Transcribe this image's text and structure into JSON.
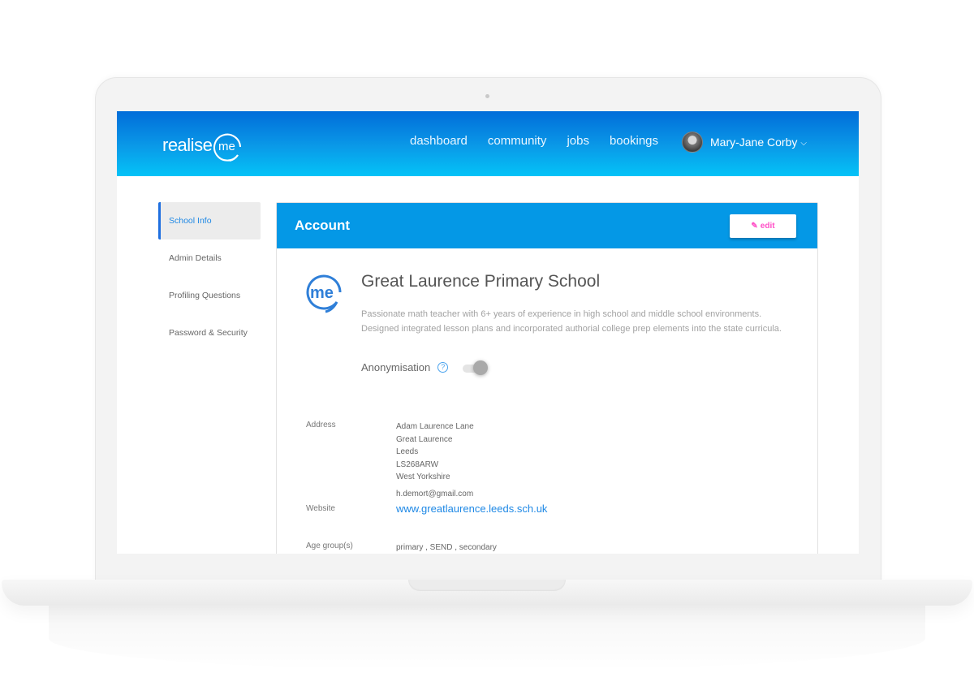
{
  "header": {
    "logo_text": "realise",
    "logo_badge": "me",
    "nav": [
      {
        "label": "dashboard"
      },
      {
        "label": "community"
      },
      {
        "label": "jobs"
      },
      {
        "label": "bookings"
      }
    ],
    "user_name": "Mary-Jane Corby",
    "user_chevron": "⌵"
  },
  "sidebar": {
    "items": [
      {
        "label": "School Info",
        "active": true
      },
      {
        "label": "Admin Details",
        "active": false
      },
      {
        "label": "Profiling Questions",
        "active": false
      },
      {
        "label": "Password & Security",
        "active": false
      }
    ]
  },
  "card": {
    "title": "Account",
    "edit_label": "edit",
    "edit_icon": "✎",
    "school_name": "Great Laurence Primary School",
    "logo_badge": "me",
    "bio": "Passionate math teacher with 6+ years of experience in high school and middle school environments. Designed integrated lesson plans and incorporated authorial college prep elements into the state curricula.",
    "anonymisation": {
      "label": "Anonymisation",
      "help_icon": "?",
      "enabled": false
    },
    "details": {
      "address_label": "Address",
      "address_lines": [
        "Adam Laurence Lane",
        "Great Laurence",
        "Leeds",
        "LS268ARW",
        "West Yorkshire"
      ],
      "email": "h.demort@gmail.com",
      "website_label": "Website",
      "website": "www.greatlaurence.leeds.sch.uk",
      "age_groups_label": "Age group(s)",
      "age_groups": "primary ,  SEND ,  secondary"
    }
  },
  "colors": {
    "header_top": "#016dd9",
    "header_bottom": "#04c3f7",
    "card_header": "#0498e6",
    "accent_link": "#1e88e5",
    "edit_pink": "#ff4fc7"
  }
}
